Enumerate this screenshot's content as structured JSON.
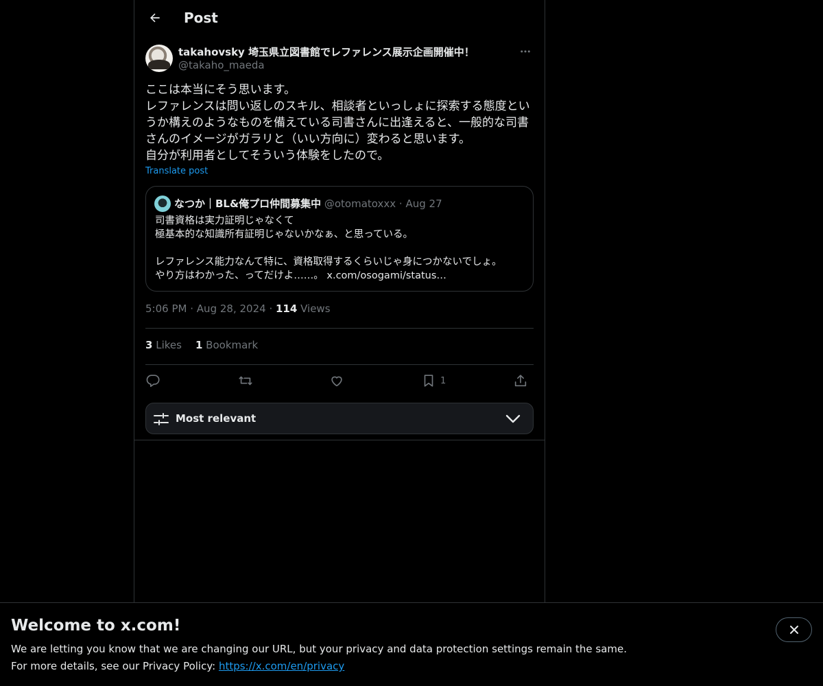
{
  "header": {
    "title": "Post",
    "back_icon": "arrow-left-icon"
  },
  "post": {
    "author_name": "takahovsky 埼玉県立図書館でレファレンス展示企画開催中！",
    "author_handle": "@takaho_maeda",
    "more_icon": "more-horizontal-icon",
    "body_lines": [
      "ここは本当にそう思います。",
      "レファレンスは問い返しのスキル、相談者といっしょに探索する態度とい",
      "うか構えのようなものを備えている司書さんに出逢えると、一般的な司書",
      "さんのイメージがガラリと（いい方向に）変わると思います。",
      "自分が利用者としてそういう体験をしたので。"
    ],
    "translate_label": "Translate post",
    "quote": {
      "name": "なつか｜BL&俺プロ仲間募集中",
      "handle": "@otomatoxxx",
      "separator": "·",
      "date": "Aug 27",
      "body_lines": [
        "司書資格は実力証明じゃなくて",
        "極基本的な知識所有証明じゃないかなぁ、と思っている。",
        "",
        "レファレンス能力なんて特に、資格取得するくらいじゃ身につかないでしょ。",
        "やり方はわかった、ってだけよ……。 x.com/osogami/status…"
      ]
    },
    "time": "5:06 PM",
    "dot": "·",
    "date": "Aug 28, 2024",
    "views_count": "114",
    "views_label": "Views",
    "likes_count": "3",
    "likes_label": "Likes",
    "bookmarks_count": "1",
    "bookmarks_label": "Bookmark",
    "actions": {
      "reply_icon": "reply-icon",
      "repost_icon": "repost-icon",
      "like_icon": "heart-icon",
      "bookmark_icon": "bookmark-icon",
      "bookmark_count": "1",
      "share_icon": "share-icon"
    }
  },
  "sort": {
    "label": "Most relevant",
    "icon": "sliders-icon",
    "chevron": "chevron-down-icon"
  },
  "banner": {
    "title": "Welcome to x.com!",
    "line1": "We are letting you know that we are changing our URL, but your privacy and data protection settings remain the same.",
    "line2_prefix": "For more details, see our Privacy Policy: ",
    "link": "https://x.com/en/privacy",
    "close_icon": "close-icon"
  },
  "colors": {
    "background": "#000000",
    "text": "#e7e9ea",
    "muted": "#71767b",
    "accent": "#1d9bf0",
    "border": "#2f3336"
  }
}
